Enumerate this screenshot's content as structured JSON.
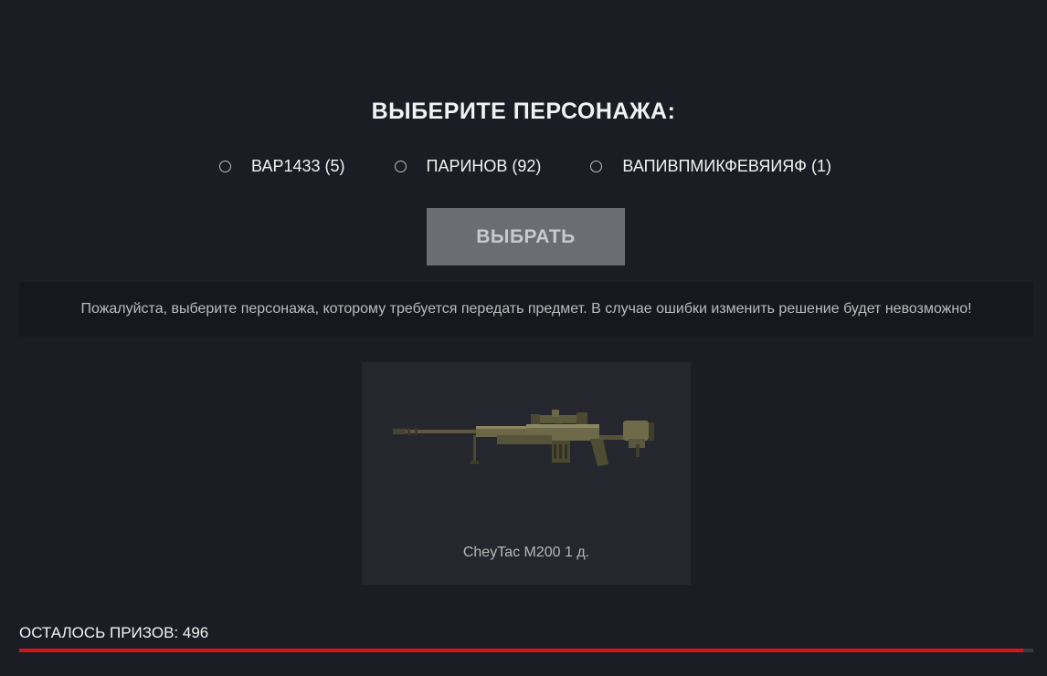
{
  "heading": "ВЫБЕРИТЕ ПЕРСОНАЖА:",
  "characters": [
    {
      "label": "ВАР1433 (5)",
      "selected": false
    },
    {
      "label": "ПАРИНОВ (92)",
      "selected": false
    },
    {
      "label": "ВАПИВПМИКФЕВЯИЯФ (1)",
      "selected": false
    }
  ],
  "select_button": "ВЫБРАТЬ",
  "notice": "Пожалуйста, выберите персонажа, которому требуется передать предмет. В случае ошибки изменить решение будет невозможно!",
  "item": {
    "icon": "sniper-rifle-icon",
    "label": "CheyTac M200 1 д."
  },
  "prizes": {
    "label": "ОСТАЛОСЬ ПРИЗОВ: 496",
    "progress": 0.99
  },
  "colors": {
    "background": "#1c1d24",
    "button": "#6a6d71",
    "accent": "#d4161b"
  }
}
